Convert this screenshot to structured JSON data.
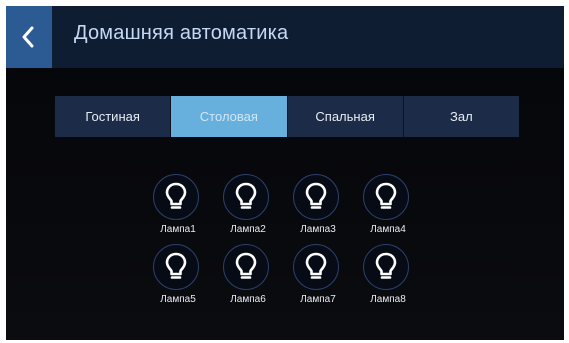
{
  "header": {
    "title": "Домашняя автоматика",
    "back_icon": "chevron-left-icon"
  },
  "tabs": [
    {
      "label": "Гостиная",
      "active": false
    },
    {
      "label": "Столовая",
      "active": true
    },
    {
      "label": "Спальная",
      "active": false
    },
    {
      "label": "Зал",
      "active": false
    }
  ],
  "lamps": [
    {
      "label": "Лампа1",
      "icon": "lightbulb-icon"
    },
    {
      "label": "Лампа2",
      "icon": "lightbulb-icon"
    },
    {
      "label": "Лампа3",
      "icon": "lightbulb-icon"
    },
    {
      "label": "Лампа4",
      "icon": "lightbulb-icon"
    },
    {
      "label": "Лампа5",
      "icon": "lightbulb-icon"
    },
    {
      "label": "Лампа6",
      "icon": "lightbulb-icon"
    },
    {
      "label": "Лампа7",
      "icon": "lightbulb-icon"
    },
    {
      "label": "Лампа8",
      "icon": "lightbulb-icon"
    }
  ],
  "colors": {
    "header_bg": "#0f1d33",
    "back_button_bg": "#2c5a93",
    "tab_bg": "#1c2c48",
    "tab_active_bg": "#67b0de",
    "title_text": "#c5d9f2",
    "lamp_ring": "#2c3f6a"
  }
}
